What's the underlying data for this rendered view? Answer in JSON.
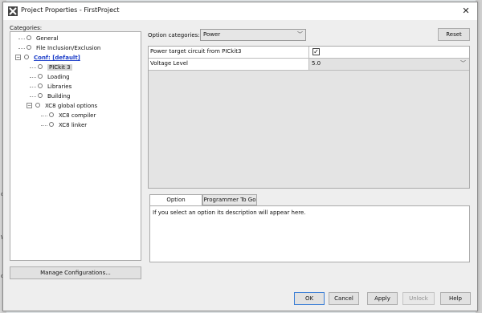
{
  "window": {
    "title": "Project Properties - FirstProject"
  },
  "background": {
    "marks": [
      "o",
      "W",
      "o"
    ]
  },
  "categories": {
    "label": "Categories:",
    "items": [
      {
        "label": "General"
      },
      {
        "label": "File Inclusion/Exclusion"
      },
      {
        "label": "Conf: [default]"
      },
      {
        "label": "PICkit 3"
      },
      {
        "label": "Loading"
      },
      {
        "label": "Libraries"
      },
      {
        "label": "Building"
      },
      {
        "label": "XC8 global options"
      },
      {
        "label": "XC8 compiler"
      },
      {
        "label": "XC8 linker"
      }
    ],
    "manage_button": "Manage Configurations..."
  },
  "options": {
    "categories_label": "Option categories:",
    "selected_category": "Power",
    "reset_button": "Reset",
    "rows": [
      {
        "name": "Power target circuit from PICkit3",
        "checked": true,
        "check_glyph": "✓"
      },
      {
        "name": "Voltage Level",
        "value": "5.0"
      }
    ]
  },
  "tabs": [
    {
      "label": "Option Description",
      "active": true
    },
    {
      "label": "Programmer To Go",
      "active": false
    }
  ],
  "description": "If you select an option its description will appear here.",
  "buttons": {
    "ok": "OK",
    "cancel": "Cancel",
    "apply": "Apply",
    "unlock": "Unlock",
    "help": "Help"
  }
}
